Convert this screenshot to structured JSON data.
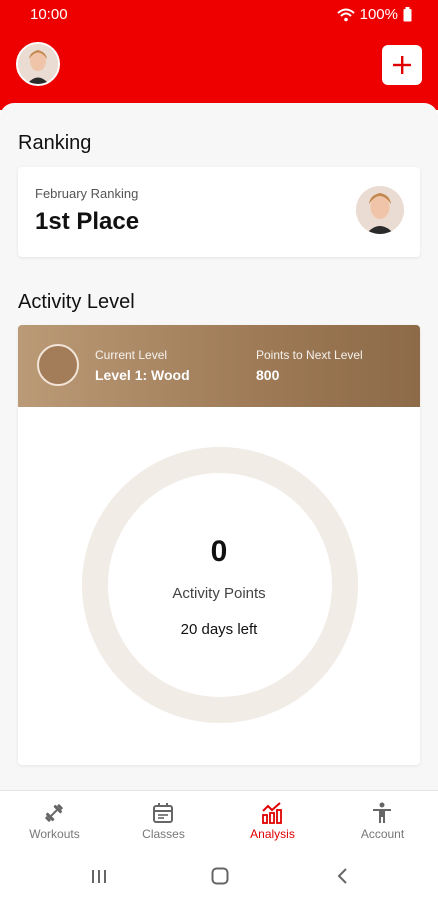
{
  "status_bar": {
    "time": "10:00",
    "battery": "100%"
  },
  "header": {
    "add_label": "+"
  },
  "ranking": {
    "title": "Ranking",
    "month_label": "February Ranking",
    "place": "1st Place"
  },
  "activity": {
    "title": "Activity Level",
    "current_level_label": "Current Level",
    "current_level_value": "Level 1: Wood",
    "next_level_label": "Points to Next Level",
    "next_level_value": "800",
    "points": "0",
    "points_label": "Activity Points",
    "days_left": "20 days left"
  },
  "nav": {
    "items": [
      {
        "label": "Workouts",
        "icon": "dumbbell-icon"
      },
      {
        "label": "Classes",
        "icon": "calendar-icon"
      },
      {
        "label": "Analysis",
        "icon": "chart-icon"
      },
      {
        "label": "Account",
        "icon": "person-icon"
      }
    ],
    "active_index": 2
  },
  "colors": {
    "brand_red": "#ee0000",
    "active_nav": "#e00000",
    "wood_gradient_start": "#bb9a77",
    "wood_gradient_end": "#8d6a48",
    "ring": "#f1ece6"
  }
}
